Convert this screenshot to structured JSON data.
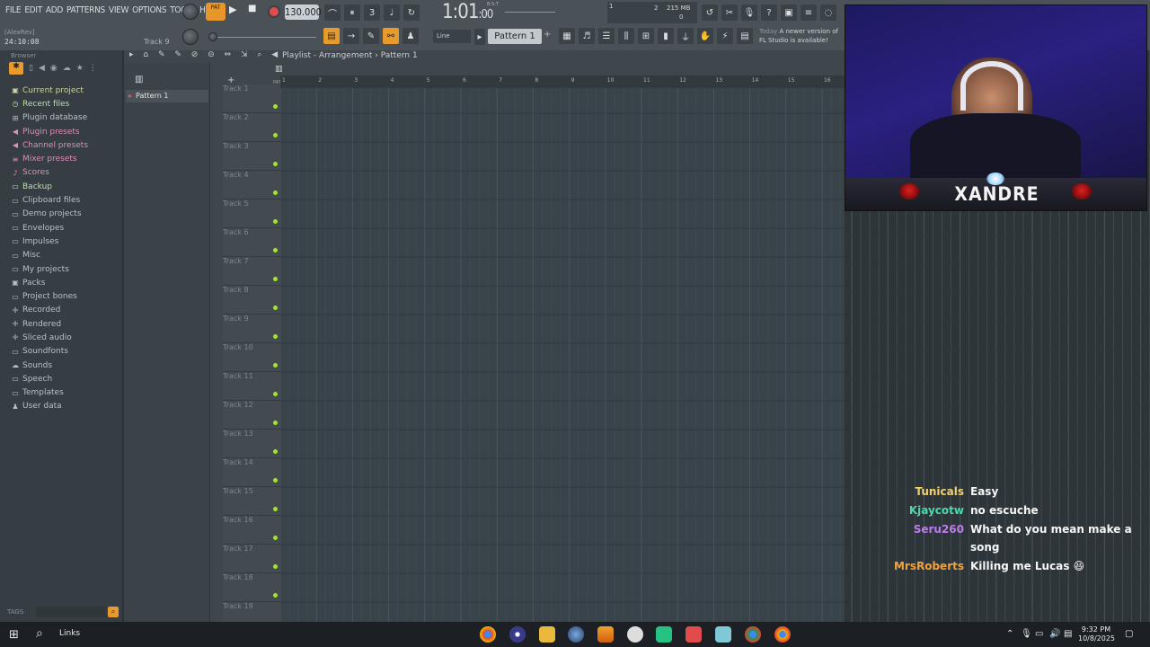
{
  "menu": [
    "FILE",
    "EDIT",
    "ADD",
    "PATTERNS",
    "VIEW",
    "OPTIONS",
    "TOOLS",
    "HELP"
  ],
  "project": {
    "name": "[AlexRev]",
    "time": "24:10:08",
    "track_hint": "Track 9"
  },
  "transport": {
    "pat_song": "PAT",
    "tempo": "130.000",
    "bst": "B:S:T",
    "time_main": "1:01",
    "time_sub": ":00"
  },
  "monitor": {
    "voices": "2",
    "memory": "215 MB",
    "cpu": "0",
    "cursor_mark": "1"
  },
  "pattern_selector": {
    "label": "Pattern 1",
    "plus": "+"
  },
  "snap": {
    "label": "Line"
  },
  "news": {
    "label": "Today",
    "line1": "A newer version of",
    "line2": "FL Studio is available!"
  },
  "browser": {
    "header": "Browser",
    "items": [
      {
        "label": "Current project",
        "icon": "▣",
        "style": "gold"
      },
      {
        "label": "Recent files",
        "icon": "◷",
        "style": "green"
      },
      {
        "label": "Plugin database",
        "icon": "⊞",
        "style": "plain"
      },
      {
        "label": "Plugin presets",
        "icon": "◀",
        "style": "pink"
      },
      {
        "label": "Channel presets",
        "icon": "◀",
        "style": "pink"
      },
      {
        "label": "Mixer presets",
        "icon": "≡",
        "style": "pink"
      },
      {
        "label": "Scores",
        "icon": "♪",
        "style": "pink"
      },
      {
        "label": "Backup",
        "icon": "▭",
        "style": "green"
      },
      {
        "label": "Clipboard files",
        "icon": "▭",
        "style": "plain"
      },
      {
        "label": "Demo projects",
        "icon": "▭",
        "style": "plain"
      },
      {
        "label": "Envelopes",
        "icon": "▭",
        "style": "plain"
      },
      {
        "label": "Impulses",
        "icon": "▭",
        "style": "plain"
      },
      {
        "label": "Misc",
        "icon": "▭",
        "style": "plain"
      },
      {
        "label": "My projects",
        "icon": "▭",
        "style": "plain"
      },
      {
        "label": "Packs",
        "icon": "▣",
        "style": "plain"
      },
      {
        "label": "Project bones",
        "icon": "▭",
        "style": "plain"
      },
      {
        "label": "Recorded",
        "icon": "✛",
        "style": "plain"
      },
      {
        "label": "Rendered",
        "icon": "✛",
        "style": "plain"
      },
      {
        "label": "Sliced audio",
        "icon": "✛",
        "style": "plain"
      },
      {
        "label": "Soundfonts",
        "icon": "▭",
        "style": "plain"
      },
      {
        "label": "Sounds",
        "icon": "☁",
        "style": "plain"
      },
      {
        "label": "Speech",
        "icon": "▭",
        "style": "plain"
      },
      {
        "label": "Templates",
        "icon": "▭",
        "style": "plain"
      },
      {
        "label": "User data",
        "icon": "♟",
        "style": "plain"
      }
    ],
    "tags_label": "TAGS"
  },
  "playlist": {
    "title": "Playlist - Arrangement",
    "pattern": "Pattern 1",
    "picker_item": "Pattern 1",
    "picker_plus": "+",
    "pat_label": "PAT",
    "ruler": [
      "1",
      "2",
      "3",
      "4",
      "5",
      "6",
      "7",
      "8",
      "9",
      "10",
      "11",
      "12",
      "13",
      "14",
      "15",
      "16"
    ],
    "tracks": [
      "Track 1",
      "Track 2",
      "Track 3",
      "Track 4",
      "Track 5",
      "Track 6",
      "Track 7",
      "Track 8",
      "Track 9",
      "Track 10",
      "Track 11",
      "Track 12",
      "Track 13",
      "Track 14",
      "Track 15",
      "Track 16",
      "Track 17",
      "Track 18",
      "Track 19"
    ]
  },
  "webcam": {
    "name": "XANDRE"
  },
  "chat": [
    {
      "user": "Tunicals",
      "color": "#f0d070",
      "text": "Easy"
    },
    {
      "user": "Kjaycotw",
      "color": "#4fd6b0",
      "text": "no escuche"
    },
    {
      "user": "Seru260",
      "color": "#c07af0",
      "text": "What do you mean make a",
      "text2": "song"
    },
    {
      "user": "MrsRoberts",
      "color": "#f2a23a",
      "text": "Killing me Lucas 😆"
    }
  ],
  "taskbar": {
    "links": "Links",
    "time": "9:32 PM",
    "date": "10/8/2025"
  },
  "colors": {
    "accent": "#e89a2c",
    "led": "#a6e03a",
    "record": "#e24b4b"
  }
}
